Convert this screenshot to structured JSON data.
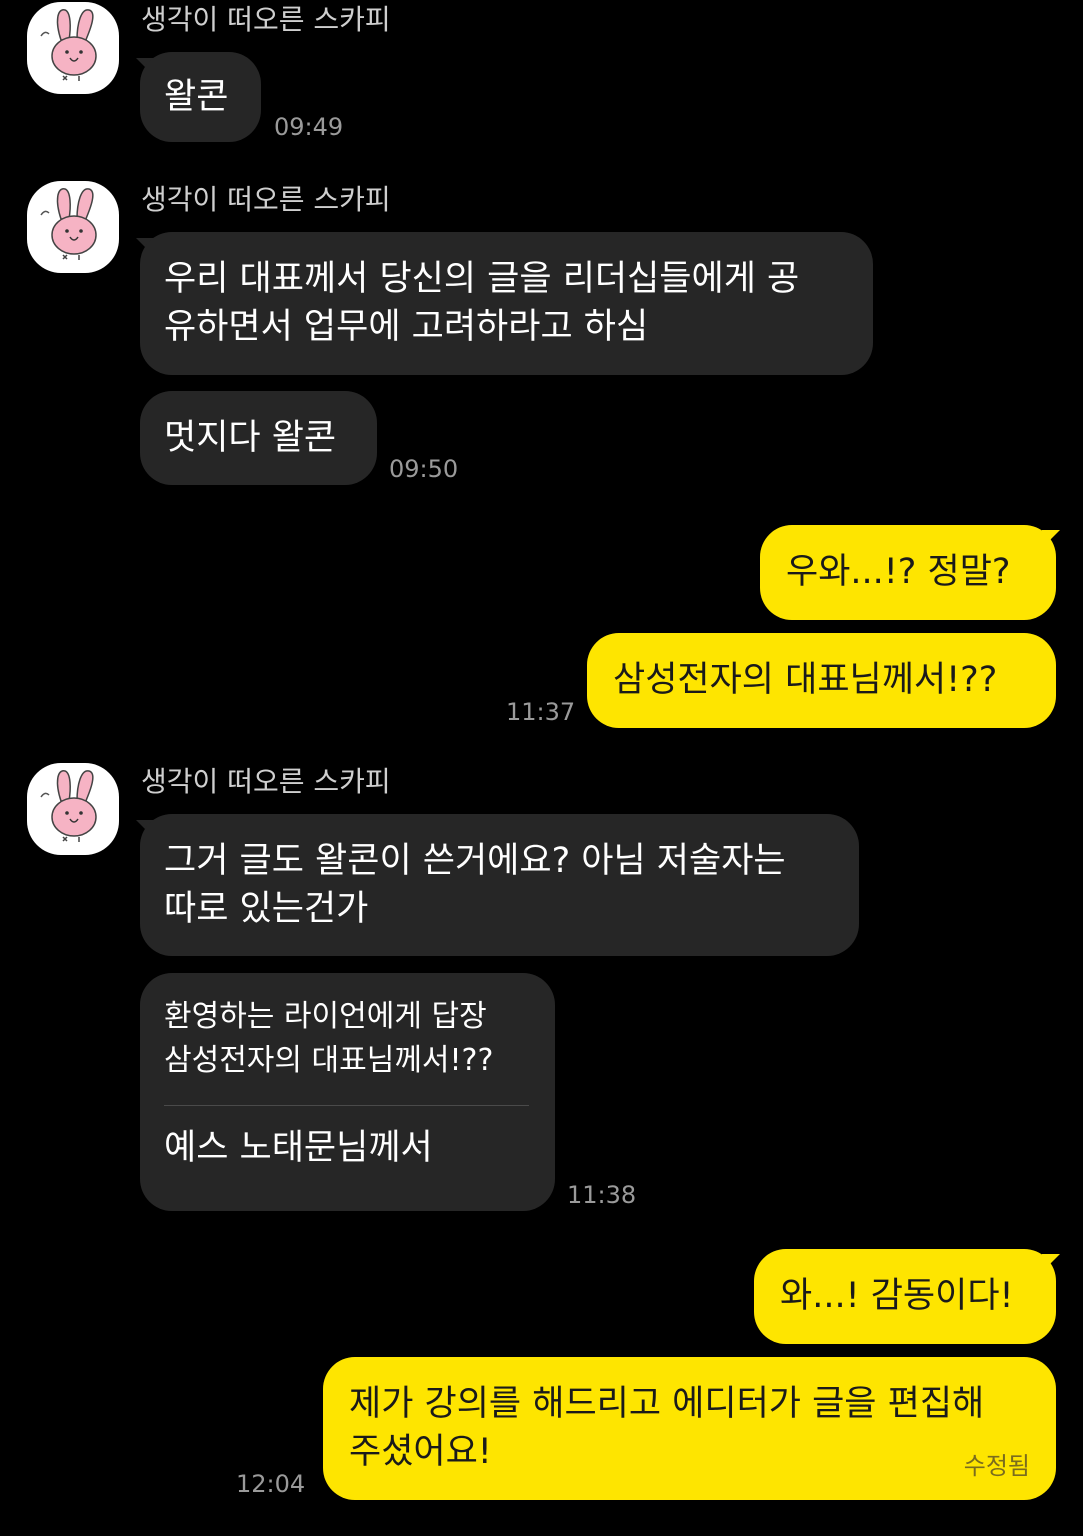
{
  "sender_name": "생각이 떠오른 스카피",
  "messages": [
    {
      "text": "왈콘",
      "time": "09:49"
    },
    {
      "text_line1": "우리 대표께서 당신의 글을 리더십들에게 공",
      "text_line2": "유하면서 업무에 고려하라고 하심"
    },
    {
      "text": "멋지다 왈콘",
      "time": "09:50"
    },
    {
      "text": "우와...!? 정말?"
    },
    {
      "text": "삼성전자의 대표님께서!??",
      "time": "11:37"
    },
    {
      "text_line1": "그거 글도 왈콘이 쓴거에요? 아님 저술자는",
      "text_line2": "따로 있는건가"
    },
    {
      "quote_line1": "환영하는 라이언에게 답장",
      "quote_line2": "삼성전자의 대표님께서!??",
      "text": "예스 노태문님께서",
      "time": "11:38"
    },
    {
      "text": "와...! 감동이다!"
    },
    {
      "text_line1": "제가 강의를 해드리고 에디터가 글을 편집해",
      "text_line2": "주셨어요!",
      "edited_label": "수정됨",
      "time": "12:04"
    }
  ],
  "colors": {
    "background": "#000000",
    "incoming_bubble": "#262626",
    "outgoing_bubble": "#fee500",
    "timestamp": "#9a9a9a"
  },
  "icons": {
    "avatar": "pink-rabbit-avatar-icon"
  }
}
